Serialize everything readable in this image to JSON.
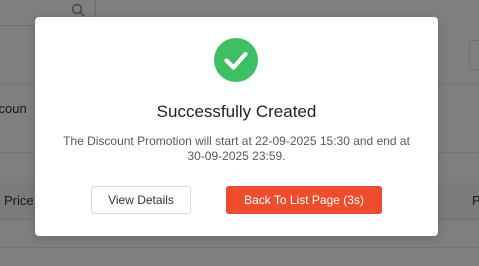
{
  "background": {
    "left_text": "scoun",
    "price_label": "Price",
    "right_text": "P"
  },
  "modal": {
    "title": "Successfully Created",
    "message": "The Discount Promotion will start at 22-09-2025 15:30 and end at 30-09-2025 23:59.",
    "view_details_label": "View Details",
    "back_to_list_label": "Back To List Page (3s)",
    "success_icon": "check-circle-icon"
  },
  "colors": {
    "success": "#3fbf63",
    "primary": "#ee4d2d",
    "overlay": "rgba(0,0,0,0.5)"
  }
}
